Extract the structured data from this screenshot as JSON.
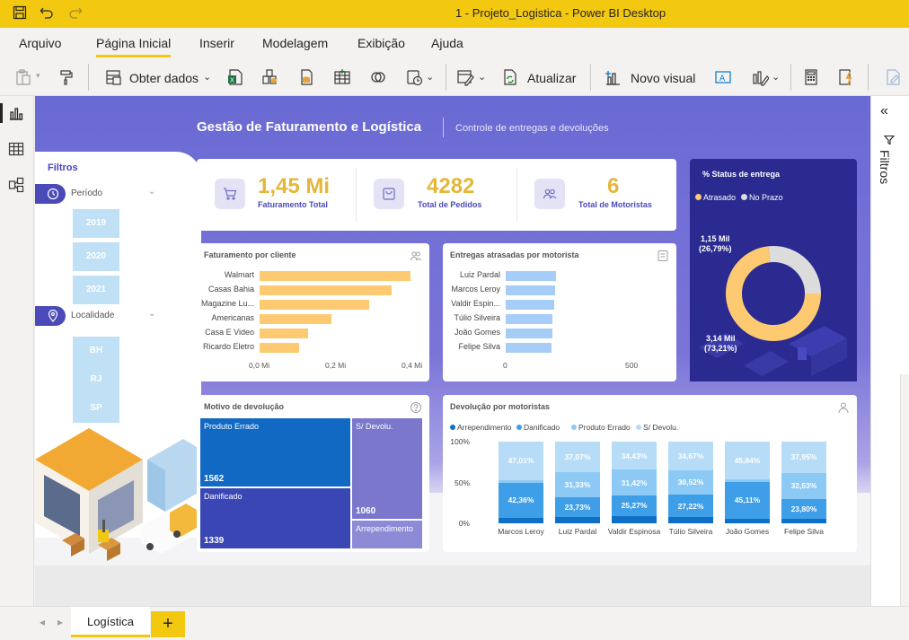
{
  "window": {
    "title": "1 - Projeto_Logistica - Power BI Desktop"
  },
  "menu_tabs": [
    "Arquivo",
    "Página Inicial",
    "Inserir",
    "Modelagem",
    "Exibição",
    "Ajuda"
  ],
  "ribbon": {
    "get_data": "Obter dados",
    "refresh": "Atualizar",
    "new_visual": "Novo visual"
  },
  "filter_pane": {
    "label": "Filtros"
  },
  "report": {
    "title": "Gestão de Faturamento e Logística",
    "subtitle": "Controle de entregas e devoluções",
    "filters": {
      "title": "Filtros",
      "period": {
        "label": "Período",
        "options": [
          "2019",
          "2020",
          "2021"
        ]
      },
      "location": {
        "label": "Localidade",
        "options": [
          "BH",
          "RJ",
          "SP"
        ]
      }
    },
    "kpis": [
      {
        "value": "1,45 Mi",
        "label": "Faturamento Total",
        "icon": "cart-icon"
      },
      {
        "value": "4282",
        "label": "Total de Pedidos",
        "icon": "bag-icon"
      },
      {
        "value": "6",
        "label": "Total de Motoristas",
        "icon": "people-icon"
      }
    ],
    "donut_labels": {
      "late": "1,15 Mil\n(26,79%)",
      "ontime": "3,14 Mil\n(73,21%)"
    }
  },
  "pages": {
    "active": "Logística",
    "add": "+"
  },
  "colors": {
    "accent": "#f3c811",
    "bar_yellow": "#fdc971",
    "bar_blue": "#a6cdf7",
    "treemap_blue": "#1269c4",
    "treemap_indigo": "#3a46b4",
    "treemap_lavender": "#7a77cc",
    "stack_dark": "#0f6fc7",
    "stack_mid": "#3f9ee8",
    "stack_light": "#8ccaf5",
    "stack_pale": "#b7dcf7"
  },
  "chart_data": [
    {
      "type": "bar",
      "title": "Faturamento por cliente",
      "orientation": "horizontal",
      "categories": [
        "Walmart",
        "Casas Bahia",
        "Magazine Lu...",
        "Americanas",
        "Casa E Video",
        "Ricardo Eletro"
      ],
      "values": [
        0.4,
        0.35,
        0.29,
        0.19,
        0.13,
        0.105
      ],
      "xticks": [
        "0,0 Mi",
        "0,2 Mi",
        "0,4 Mi"
      ],
      "xlim": [
        0,
        0.42
      ]
    },
    {
      "type": "bar",
      "title": "Entregas atrasadas por motorista",
      "orientation": "horizontal",
      "categories": [
        "Luiz Pardal",
        "Marcos Leroy",
        "Valdir Espin...",
        "Túlio Silveira",
        "João Gomes",
        "Felipe Silva"
      ],
      "values": [
        217,
        214,
        210,
        201,
        200,
        197
      ],
      "xticks": [
        "0",
        "500"
      ],
      "xlim": [
        0,
        690
      ]
    },
    {
      "type": "pie",
      "title": "% Status de entrega",
      "legend": [
        "Atrasado",
        "No Prazo"
      ],
      "values": [
        3.14,
        1.15
      ],
      "labels": [
        "Atrasado",
        "No Prazo"
      ]
    },
    {
      "type": "table",
      "title": "Motivo de devolução",
      "items": [
        {
          "name": "Produto Errado",
          "value": 1562
        },
        {
          "name": "Danificado",
          "value": 1339
        },
        {
          "name": "S/ Devolu.",
          "value": 1060
        },
        {
          "name": "Arrependimento",
          "value": 0
        }
      ]
    },
    {
      "type": "bar",
      "stacked": "100%",
      "title": "Devolução por motoristas",
      "categories": [
        "Marcos Leroy",
        "Luiz Pardal",
        "Valdir Espinosa",
        "Túlio Silveira",
        "João Gomes",
        "Felipe Silva"
      ],
      "yticks": [
        "0%",
        "50%",
        "100%"
      ],
      "series": [
        {
          "name": "Arrependimento",
          "values": [
            7.0,
            7.6,
            8.9,
            7.6,
            5.5,
            5.7
          ]
        },
        {
          "name": "Danificado",
          "values": [
            42.36,
            23.73,
            25.27,
            27.22,
            45.11,
            23.8
          ]
        },
        {
          "name": "Produto Errado",
          "values": [
            3.63,
            31.33,
            31.42,
            30.52,
            3.55,
            32.53
          ]
        },
        {
          "name": "S/ Devolu.",
          "values": [
            47.01,
            37.07,
            34.43,
            34.67,
            45.84,
            37.95
          ]
        }
      ],
      "data_labels": [
        [
          "",
          "42,36%",
          "",
          "47,01%"
        ],
        [
          "",
          "23,73%",
          "31,33%",
          "37,07%"
        ],
        [
          "",
          "25,27%",
          "31,42%",
          "34,43%"
        ],
        [
          "",
          "27,22%",
          "30,52%",
          "34,67%"
        ],
        [
          "",
          "45,11%",
          "",
          "45,84%"
        ],
        [
          "",
          "23,80%",
          "32,53%",
          "37,95%"
        ]
      ]
    }
  ]
}
